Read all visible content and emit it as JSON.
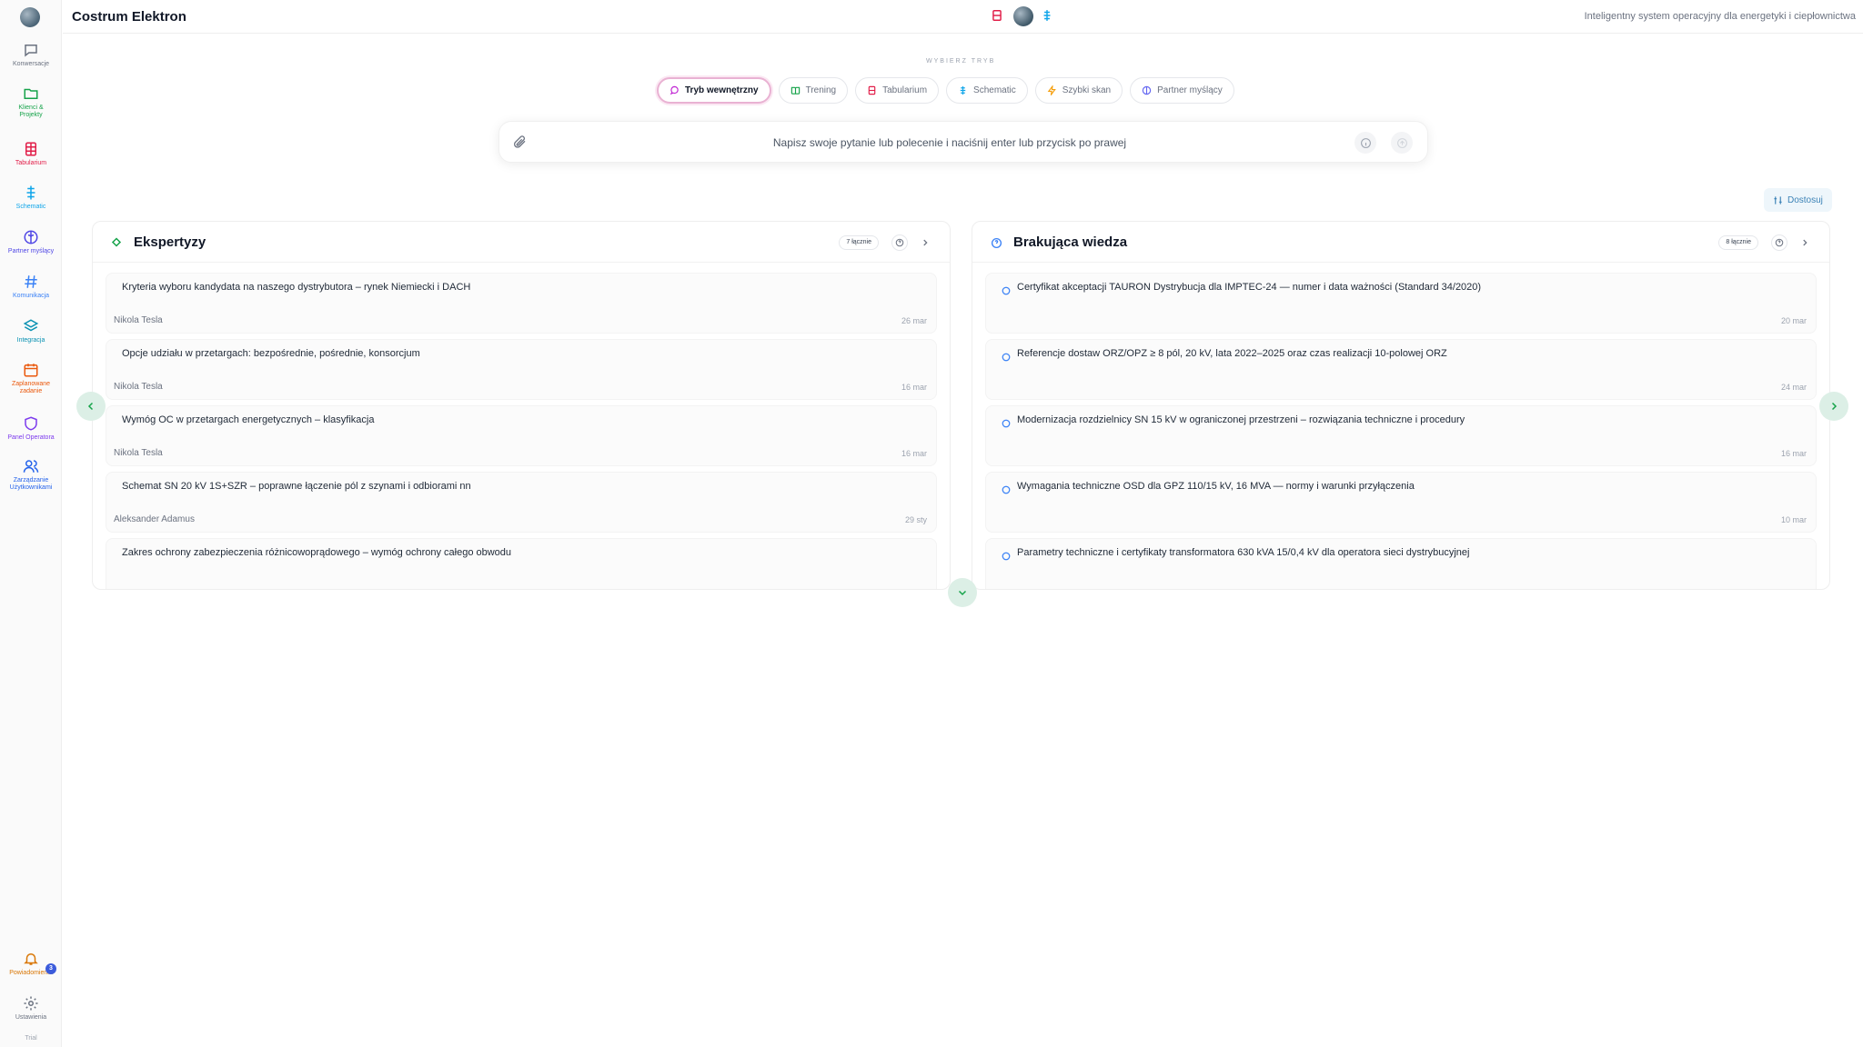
{
  "app": {
    "title": "Costrum Elektron",
    "subtitle": "Inteligentny system operacyjny dla energetyki i ciepłownictwa"
  },
  "sidebar": {
    "items": [
      {
        "label": "Konwersacje",
        "icon": "chat-icon",
        "color": "#6b7280"
      },
      {
        "label": "Klienci & Projekty",
        "icon": "folder-icon",
        "color": "#16a34a"
      },
      {
        "label": "Tabularium",
        "icon": "table-icon",
        "color": "#e11d48"
      },
      {
        "label": "Schematic",
        "icon": "schematic-icon",
        "color": "#0ea5e9"
      },
      {
        "label": "Partner myślący",
        "icon": "brain-icon",
        "color": "#4f46e5"
      },
      {
        "label": "Komunikacja",
        "icon": "hash-icon",
        "color": "#3b82f6"
      },
      {
        "label": "Integracja",
        "icon": "layers-icon",
        "color": "#0891b2"
      },
      {
        "label": "Zaplanowane zadanie",
        "icon": "calendar-icon",
        "color": "#ea580c"
      },
      {
        "label": "Panel Operatora",
        "icon": "shield-icon",
        "color": "#7c3aed"
      },
      {
        "label": "Zarządzanie Użytkownikami",
        "icon": "users-icon",
        "color": "#2563eb"
      }
    ],
    "bottom": [
      {
        "label": "Powiadomienia",
        "icon": "bell-icon",
        "color": "#d97706",
        "badge": "3"
      },
      {
        "label": "Ustawienia",
        "icon": "gear-icon",
        "color": "#6b7280"
      }
    ],
    "footer": "Trial"
  },
  "modes": {
    "caption": "WYBIERZ TRYB",
    "items": [
      {
        "label": "Tryb wewnętrzny",
        "icon": "chat-bubble-icon",
        "color": "#c026d3",
        "active": true
      },
      {
        "label": "Trening",
        "icon": "book-icon",
        "color": "#16a34a",
        "active": false
      },
      {
        "label": "Tabularium",
        "icon": "table-icon",
        "color": "#e11d48",
        "active": false
      },
      {
        "label": "Schematic",
        "icon": "schematic-icon",
        "color": "#0ea5e9",
        "active": false
      },
      {
        "label": "Szybki skan",
        "icon": "bolt-icon",
        "color": "#f59e0b",
        "active": false
      },
      {
        "label": "Partner myślący",
        "icon": "brain-icon",
        "color": "#6366f1",
        "active": false
      }
    ]
  },
  "prompt": {
    "placeholder": "Napisz swoje pytanie lub polecenie i naciśnij enter lub przycisk po prawej"
  },
  "adjust_label": "Dostosuj",
  "panels": {
    "left": {
      "title": "Ekspertyzy",
      "count": "7 łącznie",
      "items": [
        {
          "title": "Kryteria wyboru kandydata na naszego dystrybutora – rynek Niemiecki i DACH",
          "author": "Nikola Tesla",
          "date": "26 mar"
        },
        {
          "title": "Opcje udziału w przetargach: bezpośrednie, pośrednie, konsorcjum",
          "author": "Nikola Tesla",
          "date": "16 mar"
        },
        {
          "title": "Wymóg OC w przetargach energetycznych – klasyfikacja",
          "author": "Nikola Tesla",
          "date": "16 mar"
        },
        {
          "title": "Schemat SN 20 kV 1S+SZR – poprawne łączenie pól z szynami i odbiorami nn",
          "author": "Aleksander Adamus",
          "date": "29 sty"
        },
        {
          "title": "Zakres ochrony zabezpieczenia różnicowoprądowego – wymóg ochrony całego obwodu",
          "author": "",
          "date": ""
        }
      ]
    },
    "right": {
      "title": "Brakująca wiedza",
      "count": "8 łącznie",
      "items": [
        {
          "title": "Certyfikat akceptacji TAURON Dystrybucja dla IMPTEC-24 — numer i data ważności (Standard 34/2020)",
          "date": "20 mar"
        },
        {
          "title": "Referencje dostaw ORZ/OPZ ≥ 8 pól, 20 kV, lata 2022–2025 oraz czas realizacji 10-polowej ORZ",
          "date": "24 mar"
        },
        {
          "title": "Modernizacja rozdzielnicy SN 15 kV w ograniczonej przestrzeni – rozwiązania techniczne i procedury",
          "date": "16 mar"
        },
        {
          "title": "Wymagania techniczne OSD dla GPZ 110/15 kV, 16 MVA — normy i warunki przyłączenia",
          "date": "10 mar"
        },
        {
          "title": "Parametry techniczne i certyfikaty transformatora 630 kVA 15/0,4 kV dla operatora sieci dystrybucyjnej",
          "date": ""
        }
      ]
    }
  }
}
